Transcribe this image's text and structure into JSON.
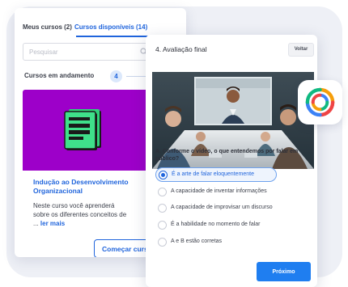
{
  "courses_panel": {
    "tabs": [
      {
        "label": "Meus cursos (2)",
        "active": false
      },
      {
        "label": "Cursos disponíveis (14)",
        "active": true
      }
    ],
    "search": {
      "placeholder": "Pesquisar"
    },
    "section_label": "Cursos em andamento",
    "section_count": "4",
    "course": {
      "icon": "document-stack-icon",
      "banner_color": "#9d00c9",
      "title": "Indução ao Desenvolvimento Organizacional",
      "description": "Neste curso você aprenderá sobre os diferentes conceitos de ...",
      "read_more": "ler mais",
      "start_label": "Começar curso"
    }
  },
  "quiz_panel": {
    "title": "4. Avaliação final",
    "back_label": "Voltar",
    "video": {
      "description_icon": "video-meeting-thumbnail"
    },
    "question": "A. Conforme o vídeo, o que entendemos por falar em público?",
    "options": [
      {
        "label": "É a arte de falar eloquentemente",
        "selected": true
      },
      {
        "label": "A capacidade de inventar informações",
        "selected": false
      },
      {
        "label": "A capacidade de improvisar um discurso",
        "selected": false
      },
      {
        "label": "É a habilidade no momento de falar",
        "selected": false
      },
      {
        "label": "A e B estão corretas",
        "selected": false
      }
    ],
    "next_label": "Próximo"
  },
  "app_logo": {
    "icon": "ring-logo-icon"
  },
  "colors": {
    "accent": "#1f64dc",
    "primary_button": "#1f7ef0",
    "background": "#eef0f6"
  }
}
